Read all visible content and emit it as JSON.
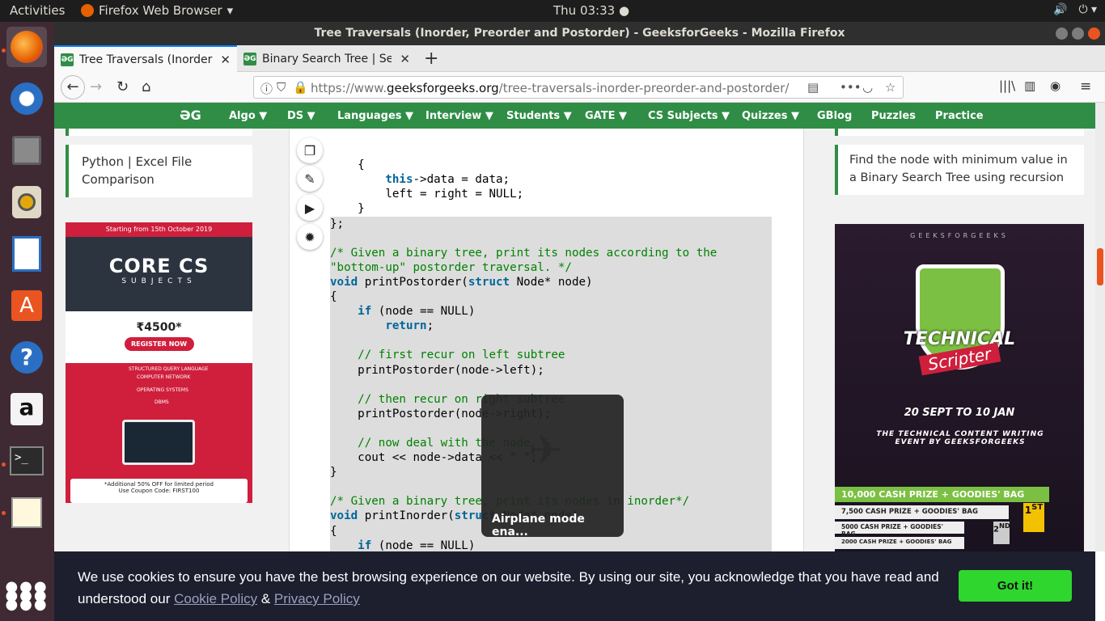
{
  "topbar": {
    "activities": "Activities",
    "app": "Firefox Web Browser",
    "clock": "Thu 03:33"
  },
  "window": {
    "title": "Tree Traversals (Inorder, Preorder and Postorder) - GeeksforGeeks - Mozilla Firefox"
  },
  "tabs": [
    {
      "label": "Tree Traversals (Inorder,"
    },
    {
      "label": "Binary Search Tree | Set"
    }
  ],
  "url": {
    "prefix": "https://www.",
    "domain": "geeksforgeeks.org",
    "path": "/tree-traversals-inorder-preorder-and-postorder/"
  },
  "menu": {
    "logo": "ƏG",
    "items": [
      "Algo ▼",
      "DS ▼",
      "Languages ▼",
      "Interview ▼",
      "Students ▼",
      "GATE ▼",
      "CS Subjects ▼",
      "Quizzes ▼",
      "GBlog",
      "Puzzles",
      "Practice"
    ]
  },
  "left_card": "Python | Excel File Comparison",
  "right_card": "Find the node with minimum value in a Binary Search Tree using recursion",
  "ad_left": {
    "date": "Starting from 15th October 2019",
    "title": "CORE CS",
    "subtitle": "SUBJECTS",
    "price": "₹4500*",
    "button": "REGISTER NOW",
    "items": [
      "STRUCTURED QUERY LANGUAGE",
      "COMPUTER NETWORK",
      "OPERATING SYSTEMS",
      "DBMS"
    ],
    "offer": "*Additional 50% OFF for limited period",
    "coupon": "Use Coupon Code: FIRST100"
  },
  "ad_right": {
    "brand": "GEEKSFORGEEKS",
    "title": "TECHNICAL",
    "subtitle": "Scripter",
    "dates": "20 SEPT TO 10 JAN",
    "event": "THE TECHNICAL CONTENT WRITING EVENT BY GEEKSFORGEEKS",
    "prizes": [
      "10,000 CASH PRIZE + GOODIES' BAG",
      "7,500 CASH PRIZE + GOODIES' BAG",
      "5000 CASH PRIZE + GOODIES' BAG",
      "2000 CASH PRIZE + GOODIES' BAG"
    ]
  },
  "osd": "Airplane mode ena...",
  "cookie": {
    "text": "We use cookies to ensure you have the best browsing experience on our website. By using our site, you acknowledge that you have read and understood our",
    "cookie_policy": "Cookie Policy",
    "amp": "&",
    "privacy_policy": "Privacy Policy",
    "button": "Got it!"
  }
}
